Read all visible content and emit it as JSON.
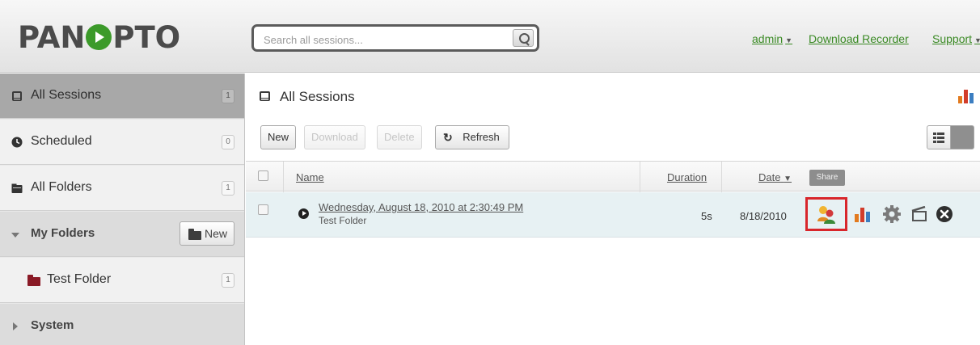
{
  "app": {
    "logo_left": "PAN",
    "logo_right": "PTO",
    "colors": {
      "brand_green": "#3c9a2a",
      "link_green": "#3a8a24",
      "highlight_red": "#d8262b",
      "row_blue": "#e7f1f3"
    }
  },
  "header": {
    "search_placeholder": "Search all sessions...",
    "links": [
      {
        "label": "admin",
        "has_caret": true
      },
      {
        "label": "Download Recorder",
        "has_caret": false
      },
      {
        "label": "Support",
        "has_caret": true
      }
    ]
  },
  "sidebar": {
    "items": [
      {
        "label": "All Sessions",
        "count": "1",
        "icon": "sessions-icon",
        "active": true
      },
      {
        "label": "Scheduled",
        "count": "0",
        "icon": "clock-icon"
      },
      {
        "label": "All Folders",
        "count": "1",
        "icon": "folders-icon"
      },
      {
        "label": "My Folders",
        "new_label": "New",
        "icon": "expand-triangle-icon"
      },
      {
        "label": "Test Folder",
        "count": "1",
        "icon": "folder-icon"
      },
      {
        "label": "System",
        "icon": "collapse-triangle-icon"
      }
    ]
  },
  "main": {
    "title": "All Sessions",
    "toolbar": {
      "new_label": "New",
      "download_label": "Download",
      "delete_label": "Delete",
      "refresh_label": "Refresh"
    },
    "table": {
      "columns": [
        "Name",
        "Duration",
        "Date"
      ],
      "sort_indicator": "▼",
      "rows": [
        {
          "title": "Wednesday, August 18, 2010 at 2:30:49 PM",
          "folder": "Test Folder",
          "duration": "5s",
          "date": "8/18/2010",
          "actions": [
            "share-icon",
            "stats-icon",
            "settings-icon",
            "editor-icon",
            "delete-icon"
          ]
        }
      ]
    },
    "tooltip": "Share"
  }
}
